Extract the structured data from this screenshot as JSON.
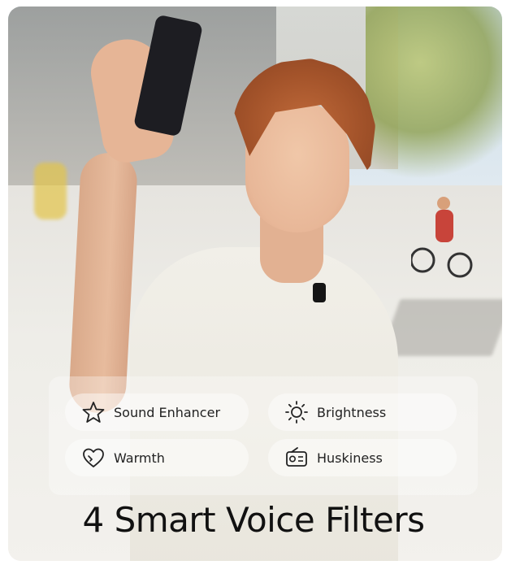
{
  "filters": {
    "items": [
      {
        "label": "Sound Enhancer",
        "icon": "star-icon"
      },
      {
        "label": "Brightness",
        "icon": "sun-icon"
      },
      {
        "label": "Warmth",
        "icon": "heart-icon"
      },
      {
        "label": "Huskiness",
        "icon": "radio-icon"
      }
    ]
  },
  "headline": "4 Smart Voice Filters",
  "colors": {
    "text": "#111111",
    "hair": "#a3532a",
    "shirt": "#f1efe8"
  }
}
